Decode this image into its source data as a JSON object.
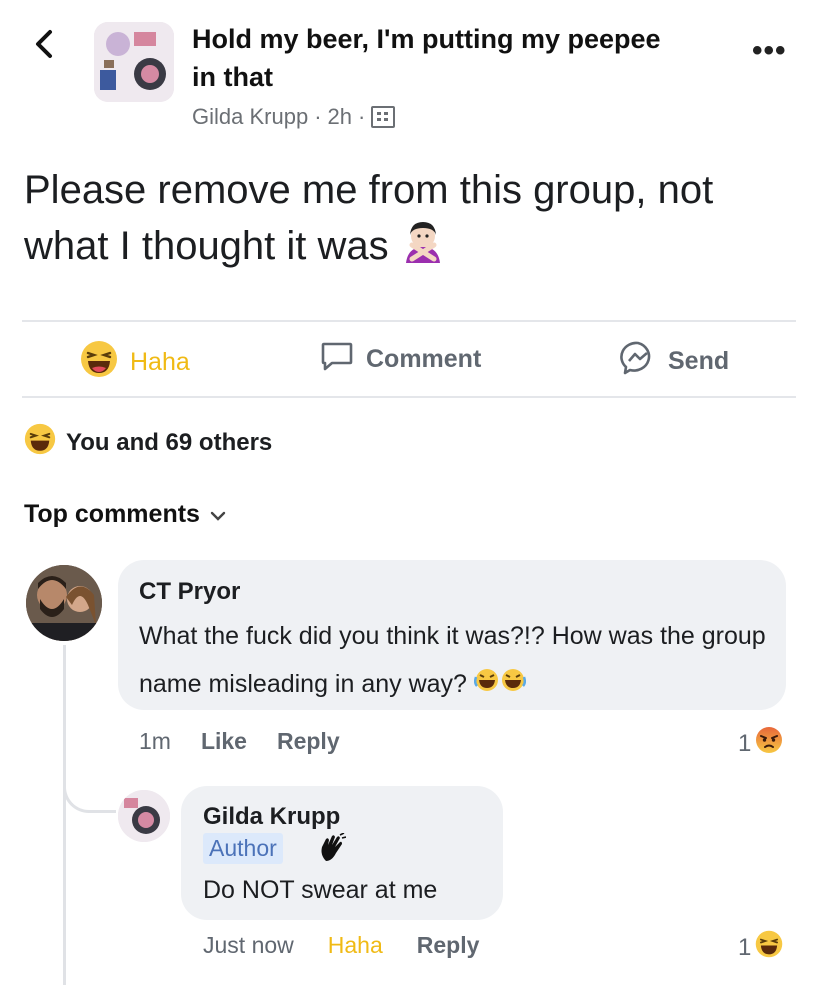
{
  "header": {
    "group_title": "Hold my beer, I'm putting my peepee in that",
    "author": "Gilda Krupp",
    "separator": "·",
    "time": "2h",
    "more_label": "•••"
  },
  "post": {
    "text": "Please remove me from this group, not what I thought it was"
  },
  "actions": {
    "haha": "Haha",
    "comment": "Comment",
    "send": "Send"
  },
  "reactions": {
    "summary": "You and 69 others"
  },
  "comments_section": {
    "sort_label": "Top comments"
  },
  "comments": [
    {
      "name": "CT Pryor",
      "text": "What the fuck did you think it was?!? How was the group name misleading in any way?",
      "time": "1m",
      "like": "Like",
      "reply": "Reply",
      "reaction_count": "1"
    },
    {
      "name": "Gilda Krupp",
      "badge": "Author",
      "text": "Do NOT swear at me",
      "time": "Just now",
      "reaction": "Haha",
      "reply": "Reply",
      "reaction_count": "1"
    }
  ],
  "colors": {
    "haha_yellow": "#f0ba15",
    "angry_orange": "#e8673a",
    "bubble": "#eff1f4",
    "author_badge_bg": "#dce9fb",
    "author_badge_text": "#4b72b8"
  },
  "icons": [
    "back-arrow-icon",
    "more-icon",
    "globe-icon",
    "haha-icon",
    "comment-icon",
    "messenger-icon",
    "chevron-down-icon",
    "angry-icon",
    "wave-icon",
    "laughing-emoji-icon",
    "gesture-emoji-icon"
  ]
}
